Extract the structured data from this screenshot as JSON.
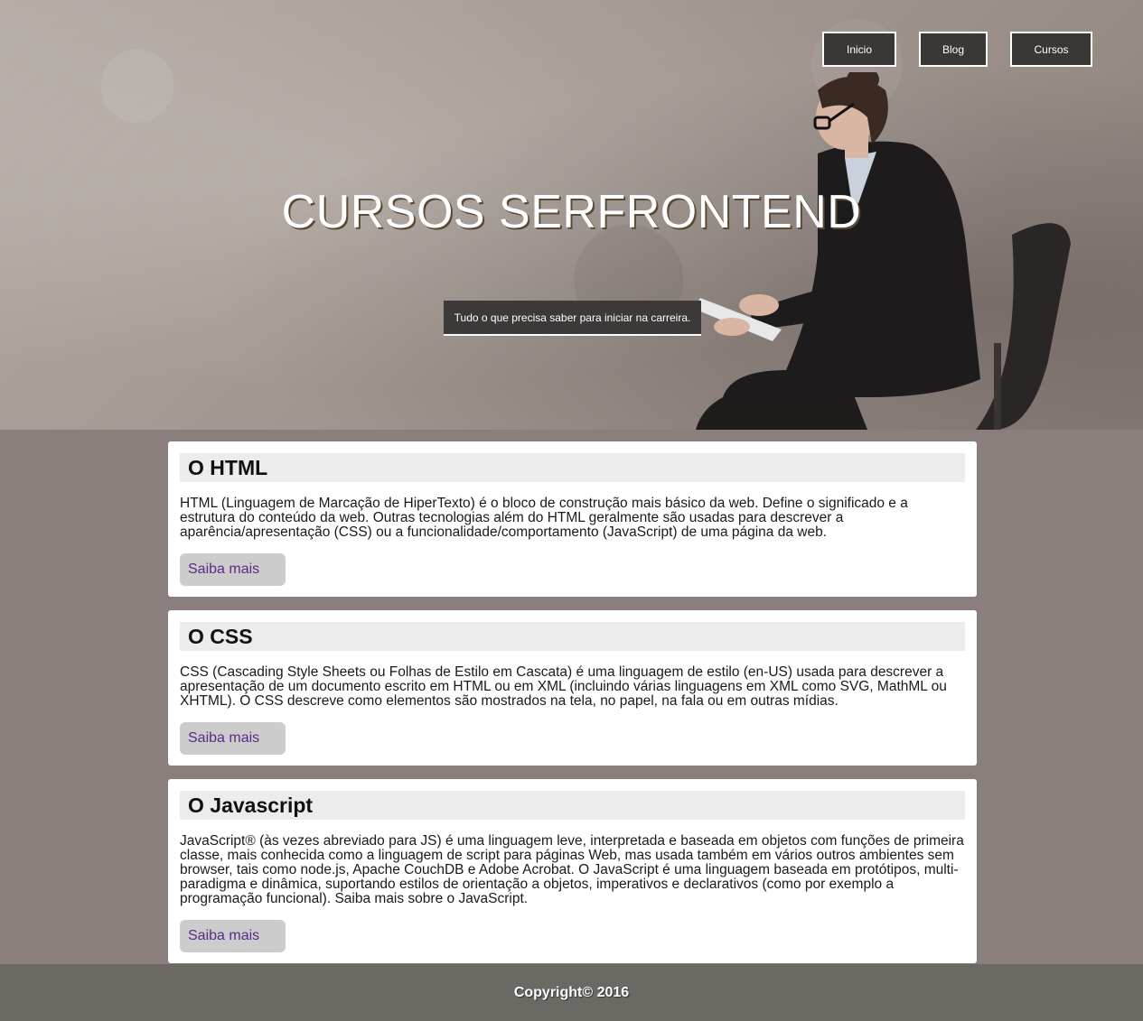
{
  "nav": {
    "items": [
      "Inicio",
      "Blog",
      "Cursos"
    ]
  },
  "hero": {
    "title": "CURSOS SERFRONTEND",
    "tagline": "Tudo o que precisa saber para iniciar na carreira."
  },
  "cards": [
    {
      "title": "O HTML",
      "text": "HTML (Linguagem de Marcação de HiperTexto) é o bloco de construção mais básico da web. Define o significado e a estrutura do conteúdo da web. Outras tecnologias além do HTML geralmente são usadas para descrever a aparência/apresentação (CSS) ou a funcionalidade/comportamento (JavaScript) de uma página da web.",
      "button": "Saiba mais"
    },
    {
      "title": "O CSS",
      "text": "CSS (Cascading Style Sheets ou Folhas de Estilo em Cascata) é uma linguagem de estilo (en-US) usada para descrever a apresentação de um documento escrito em HTML ou em XML (incluindo várias linguagens em XML como SVG, MathML ou XHTML). O CSS descreve como elementos são mostrados na tela, no papel, na fala ou em outras mídias.",
      "button": "Saiba mais"
    },
    {
      "title": "O Javascript",
      "text": "JavaScript® (às vezes abreviado para JS) é uma linguagem leve, interpretada e baseada em objetos com funções de primeira classe, mais conhecida como a linguagem de script para páginas Web, mas usada também em vários outros ambientes sem browser, tais como node.js, Apache CouchDB e Adobe Acrobat. O JavaScript é uma linguagem baseada em protótipos, multi-paradigma e dinâmica, suportando estilos de orientação a objetos, imperativos e declarativos (como por exemplo a programação funcional). Saiba mais sobre o JavaScript.",
      "button": "Saiba mais"
    }
  ],
  "footer": {
    "copyright": "Copyright© 2016"
  }
}
